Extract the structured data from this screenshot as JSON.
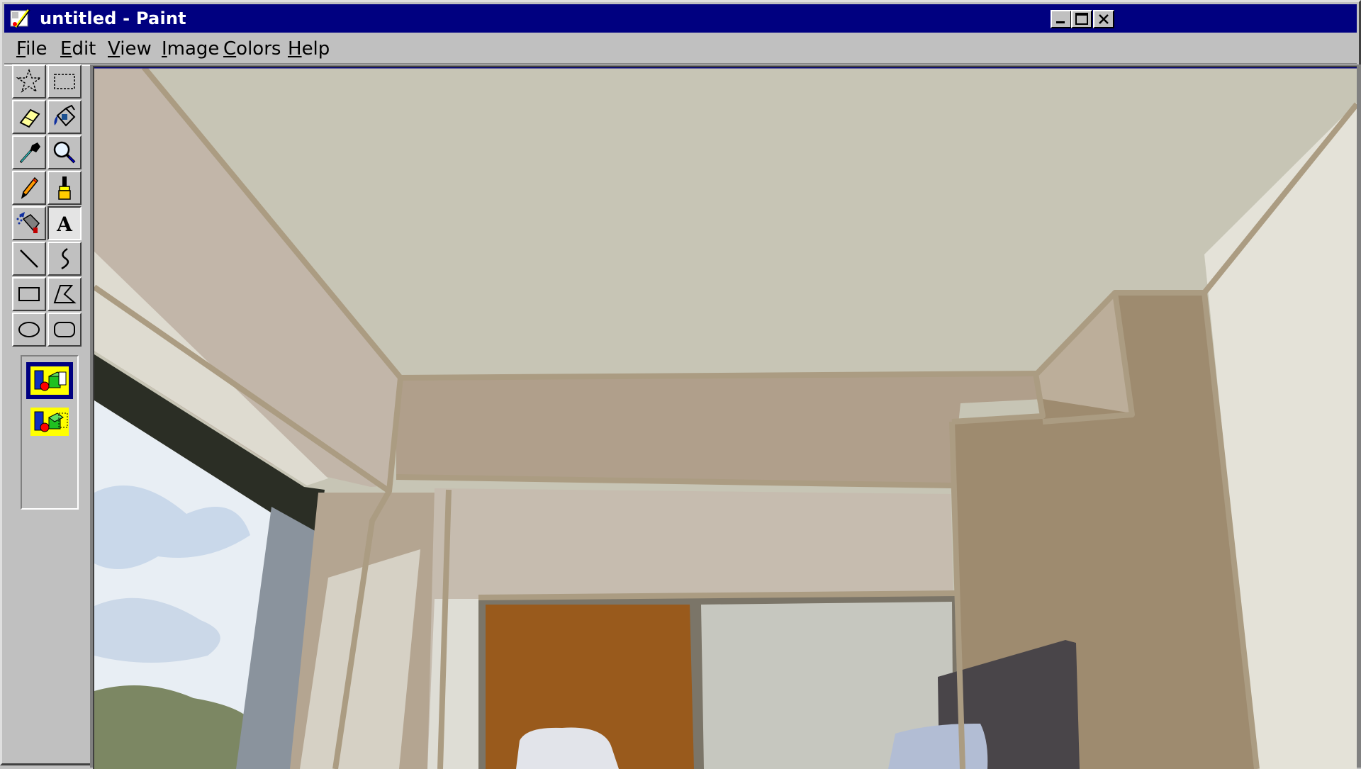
{
  "window": {
    "title": "untitled - Paint",
    "app_icon": "paint-app-icon",
    "controls": [
      "minimize-icon",
      "maximize-icon",
      "close-icon"
    ]
  },
  "menu": {
    "items": [
      {
        "id": "file",
        "mnemonic": "F",
        "rest": "ile"
      },
      {
        "id": "edit",
        "mnemonic": "E",
        "rest": "dit"
      },
      {
        "id": "view",
        "mnemonic": "V",
        "rest": "iew"
      },
      {
        "id": "image",
        "mnemonic": "I",
        "rest": "mage"
      },
      {
        "id": "colors",
        "mnemonic": "C",
        "rest": "olors"
      },
      {
        "id": "help",
        "mnemonic": "H",
        "rest": "elp"
      }
    ]
  },
  "toolbox": {
    "tools": [
      {
        "name": "free-form-select",
        "icon": "star-select-icon"
      },
      {
        "name": "select",
        "icon": "rect-select-icon"
      },
      {
        "name": "eraser",
        "icon": "eraser-icon"
      },
      {
        "name": "fill-with-color",
        "icon": "paint-bucket-icon"
      },
      {
        "name": "pick-color",
        "icon": "eyedropper-icon"
      },
      {
        "name": "magnifier",
        "icon": "magnifier-icon"
      },
      {
        "name": "pencil",
        "icon": "pencil-icon"
      },
      {
        "name": "brush",
        "icon": "brush-icon"
      },
      {
        "name": "airbrush",
        "icon": "airbrush-icon"
      },
      {
        "name": "text",
        "icon": "text-icon",
        "pressed": true
      },
      {
        "name": "line",
        "icon": "line-icon"
      },
      {
        "name": "curve",
        "icon": "curve-icon"
      },
      {
        "name": "rectangle",
        "icon": "rectangle-icon"
      },
      {
        "name": "polygon",
        "icon": "polygon-icon"
      },
      {
        "name": "ellipse",
        "icon": "ellipse-icon"
      },
      {
        "name": "rounded-rectangle",
        "icon": "rounded-rectangle-icon"
      }
    ],
    "text_tool_glyph": "A",
    "options": [
      {
        "name": "opaque-background",
        "icon": "opaque-background-icon",
        "selected": true
      },
      {
        "name": "transparent-background",
        "icon": "transparent-background-icon",
        "selected": false
      }
    ]
  },
  "canvas": {
    "image": "painting-room-interior-view",
    "colors": {
      "ceiling": "#c7c5b5",
      "beam": "#b09f8b",
      "wall_left": "#c2b6a9",
      "wall_back": "#c6bcaf",
      "column": "#9e8b6f",
      "outline": "#ab9c82",
      "right_wall": "#e4e2d8",
      "floor": "#deddd5",
      "window_frame": "#2b2e25",
      "window_post": "#8a939d",
      "sky": "#e8eef4",
      "cloud": "#c9d8ea",
      "trees": "#7c8763",
      "door": "#995a1c",
      "door_frame": "#7b7568",
      "panel": "#c6c7bf",
      "dark_cabinet": "#494549",
      "light_object": "#e2e4ea",
      "blue_object": "#b2bdd4"
    }
  }
}
